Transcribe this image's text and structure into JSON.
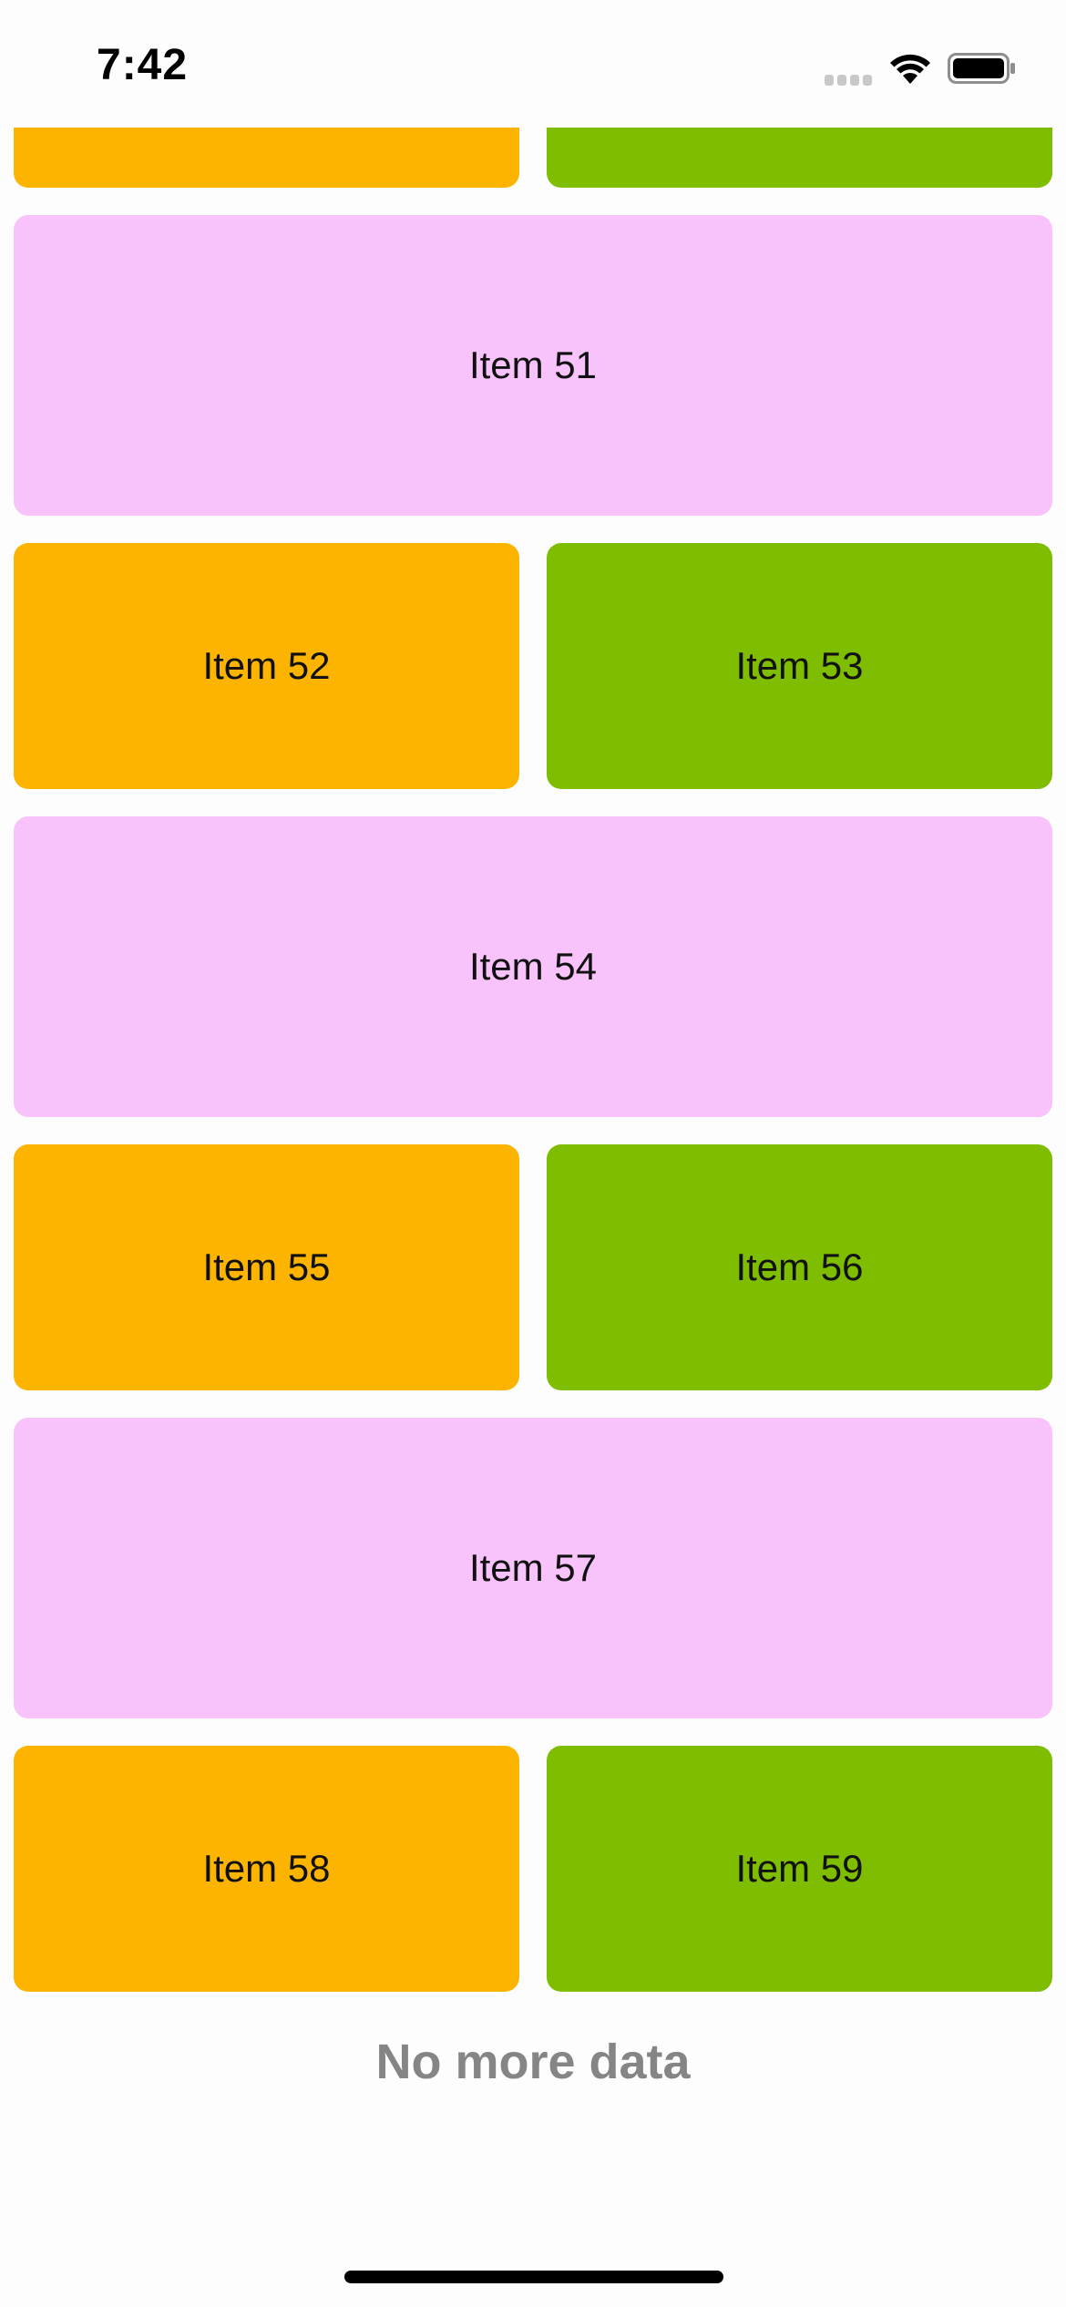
{
  "status_bar": {
    "time": "7:42",
    "icons": [
      "cellular-signal-icon",
      "wifi-icon",
      "battery-icon"
    ]
  },
  "items": {
    "partial_top_left": "",
    "partial_top_right": "",
    "item51": "Item 51",
    "item52": "Item 52",
    "item53": "Item 53",
    "item54": "Item 54",
    "item55": "Item 55",
    "item56": "Item 56",
    "item57": "Item 57",
    "item58": "Item 58",
    "item59": "Item 59"
  },
  "footer": {
    "no_more_data": "No more data"
  },
  "colors": {
    "orange": "#fdb400",
    "green": "#7ebd00",
    "pink": "#f8c2fb",
    "footer_text": "#858585"
  }
}
